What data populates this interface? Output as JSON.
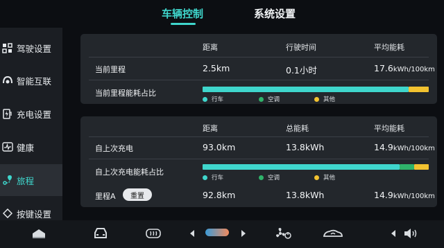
{
  "tabs": {
    "vehicle_control": "车辆控制",
    "system_settings": "系统设置"
  },
  "sidebar": {
    "items": [
      {
        "label": "驾驶设置",
        "icon": "driving-icon"
      },
      {
        "label": "智能互联",
        "icon": "connect-icon"
      },
      {
        "label": "充电设置",
        "icon": "charge-icon"
      },
      {
        "label": "健康",
        "icon": "health-icon"
      },
      {
        "label": "旅程",
        "icon": "trip-icon",
        "active": true
      },
      {
        "label": "按键设置",
        "icon": "key-icon"
      }
    ]
  },
  "current_trip": {
    "headers": {
      "distance": "距离",
      "drive_time": "行驶时间",
      "avg_consumption": "平均能耗"
    },
    "row_label": "当前里程",
    "distance": "2.5km",
    "drive_time": "0.1小时",
    "avg_consumption_value": "17.6",
    "avg_consumption_unit": "kWh/100km",
    "share_label": "当前里程能耗占比",
    "share": {
      "driving": 0.91,
      "ac": 0.0,
      "other": 0.09
    },
    "legend": {
      "driving": "行车",
      "ac": "空调",
      "other": "其他"
    }
  },
  "since_charge": {
    "headers": {
      "distance": "距离",
      "total_energy": "总能耗",
      "avg_consumption": "平均能耗"
    },
    "row_label": "自上次充电",
    "distance": "93.0km",
    "total_energy": "13.8kWh",
    "avg_consumption_value": "14.9",
    "avg_consumption_unit": "kWh/100km",
    "share_label": "自上次充电能耗占比",
    "share": {
      "driving": 0.87,
      "ac": 0.065,
      "other": 0.065
    },
    "legend": {
      "driving": "行车",
      "ac": "空调",
      "other": "其他"
    },
    "trip_a_label": "里程A",
    "reset_label": "重置",
    "trip_a_distance": "92.8km",
    "trip_a_energy": "13.8kWh",
    "trip_a_avg_value": "14.9",
    "trip_a_avg_unit": "kWh/100km"
  },
  "colors": {
    "accent": "#3fd6cc",
    "driving": "#3fd6cc",
    "ac": "#2fb36a",
    "other": "#f2c230"
  }
}
